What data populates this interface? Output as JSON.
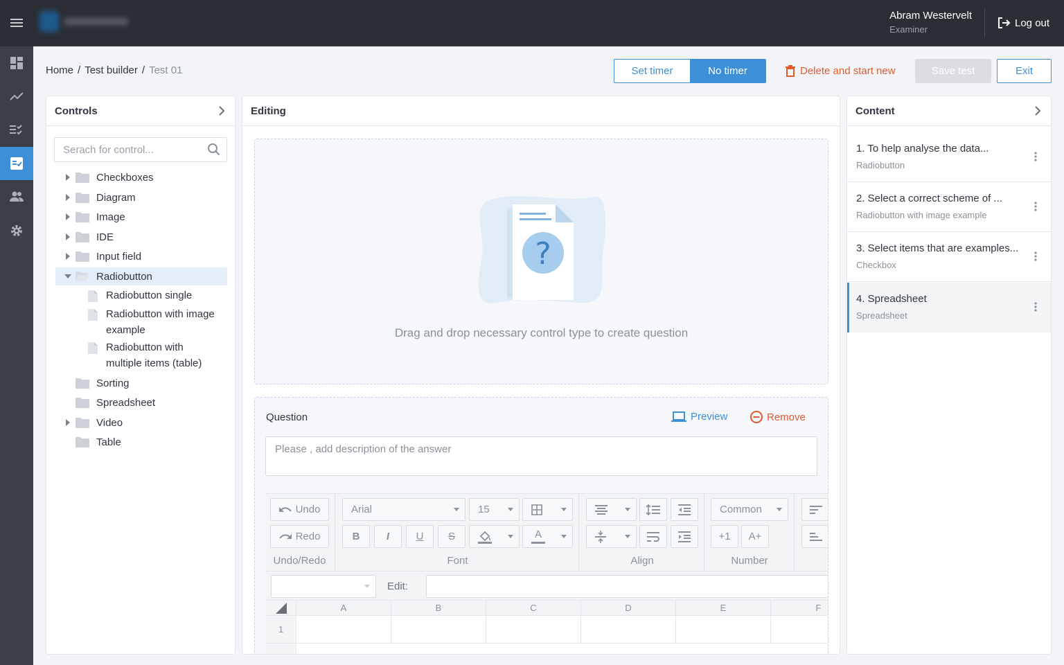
{
  "header": {
    "user_name": "Abram Westervelt",
    "user_role": "Examiner",
    "logout_label": "Log out"
  },
  "breadcrumb": {
    "home": "Home",
    "sep1": "/",
    "builder": "Test builder",
    "sep2": "/",
    "current": "Test 01"
  },
  "toolbar": {
    "set_timer": "Set timer",
    "no_timer": "No timer",
    "delete_label": "Delete and start new",
    "save_label": "Save test",
    "exit_label": "Exit"
  },
  "controls": {
    "title": "Controls",
    "search_placeholder": "Serach for control...",
    "tree": [
      {
        "label": "Checkboxes"
      },
      {
        "label": "Diagram"
      },
      {
        "label": "Image"
      },
      {
        "label": "IDE"
      },
      {
        "label": "Input field"
      },
      {
        "label": "Radiobutton"
      },
      {
        "label": "Sorting"
      },
      {
        "label": "Spreadsheet"
      },
      {
        "label": "Video"
      },
      {
        "label": "Table"
      }
    ],
    "radiobutton_children": [
      {
        "line1": "Radiobutton single",
        "line2": ""
      },
      {
        "line1": "Radiobutton with image",
        "line2": "example"
      },
      {
        "line1": "Radiobutton with",
        "line2": "multiple items (table)"
      }
    ]
  },
  "editing": {
    "title": "Editing",
    "drop_text": "Drag and drop necessary control type to create question",
    "question_label": "Question",
    "preview_label": "Preview",
    "remove_label": "Remove",
    "description_placeholder": "Please , add description of the answer",
    "ribbon": {
      "undo": "Undo",
      "redo": "Redo",
      "font_name": "Arial",
      "font_size": "15",
      "number_format": "Common",
      "plus_one": "+1",
      "a_plus": "A+",
      "bold": "B",
      "italic": "I",
      "underline": "U",
      "strike": "S",
      "font_color": "A",
      "groups": {
        "undo_redo": "Undo/Redo",
        "font": "Font",
        "align": "Align",
        "number": "Number"
      }
    },
    "edit_label": "Edit:",
    "columns": [
      "A",
      "B",
      "C",
      "D",
      "E",
      "F"
    ],
    "rows": [
      "1"
    ]
  },
  "content": {
    "title": "Content",
    "items": [
      {
        "title": "1. To help analyse the data...",
        "type": "Radiobutton"
      },
      {
        "title": "2. Select a correct scheme of ...",
        "type": "Radiobutton with image example"
      },
      {
        "title": "3. Select items that are examples...",
        "type": "Checkbox"
      },
      {
        "title": "4. Spreadsheet",
        "type": "Spreadsheet"
      }
    ],
    "active_index": 3
  },
  "colors": {
    "accent": "#3d8fd7",
    "danger": "#e35a2e",
    "topbar": "#2b2e34",
    "sidenav": "#3c3f46"
  }
}
